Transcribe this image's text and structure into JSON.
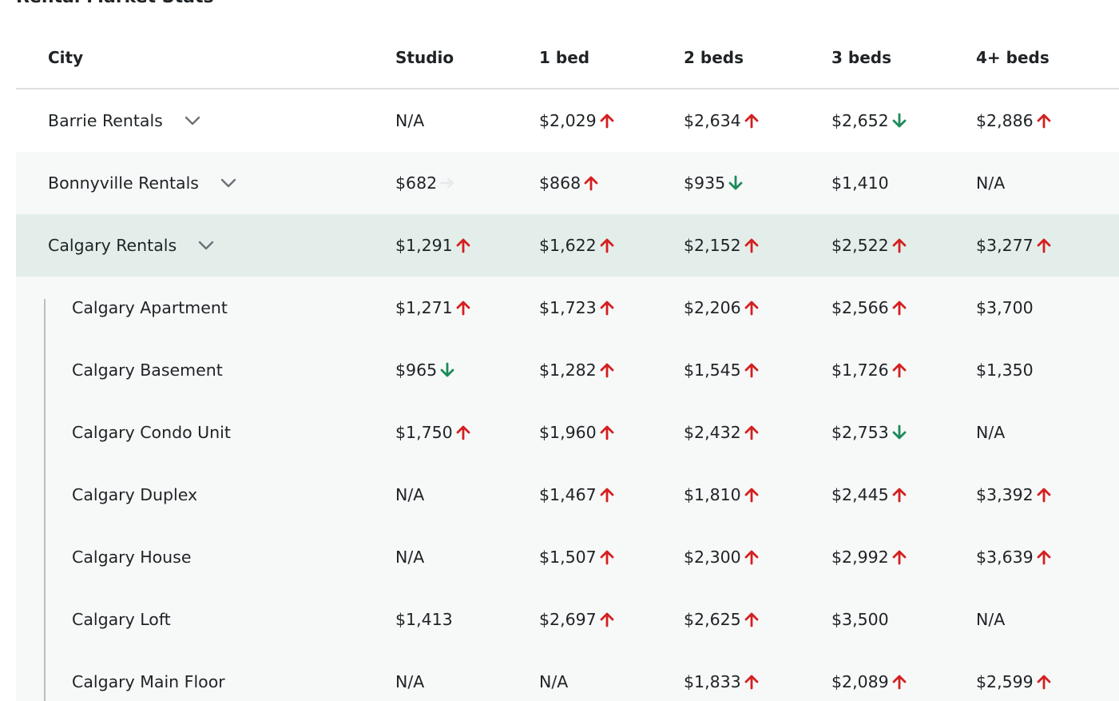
{
  "section_title": "Rental Market Stats",
  "colors": {
    "up": "#d41f1f",
    "down": "#1d8a5a",
    "flat": "#e6e9eb",
    "highlight_row": "#e3eeea",
    "alt_row": "#f7f8f8"
  },
  "columns": [
    "City",
    "Studio",
    "1 bed",
    "2 beds",
    "3 beds",
    "4+ beds"
  ],
  "rows": [
    {
      "city": "Barrie Rentals",
      "expandable": true,
      "child": false,
      "style": "plain",
      "cells": [
        {
          "value": "N/A",
          "trend": "none"
        },
        {
          "value": "$2,029",
          "trend": "up"
        },
        {
          "value": "$2,634",
          "trend": "up"
        },
        {
          "value": "$2,652",
          "trend": "down"
        },
        {
          "value": "$2,886",
          "trend": "up"
        }
      ]
    },
    {
      "city": "Bonnyville Rentals",
      "expandable": true,
      "child": false,
      "style": "alt",
      "cells": [
        {
          "value": "$682",
          "trend": "flat"
        },
        {
          "value": "$868",
          "trend": "up"
        },
        {
          "value": "$935",
          "trend": "down"
        },
        {
          "value": "$1,410",
          "trend": "none"
        },
        {
          "value": "N/A",
          "trend": "none"
        }
      ]
    },
    {
      "city": "Calgary Rentals",
      "expandable": true,
      "child": false,
      "style": "highlight",
      "cells": [
        {
          "value": "$1,291",
          "trend": "up"
        },
        {
          "value": "$1,622",
          "trend": "up"
        },
        {
          "value": "$2,152",
          "trend": "up"
        },
        {
          "value": "$2,522",
          "trend": "up"
        },
        {
          "value": "$3,277",
          "trend": "up"
        }
      ]
    },
    {
      "city": "Calgary Apartment",
      "expandable": false,
      "child": true,
      "style": "alt",
      "cells": [
        {
          "value": "$1,271",
          "trend": "up"
        },
        {
          "value": "$1,723",
          "trend": "up"
        },
        {
          "value": "$2,206",
          "trend": "up"
        },
        {
          "value": "$2,566",
          "trend": "up"
        },
        {
          "value": "$3,700",
          "trend": "none"
        }
      ]
    },
    {
      "city": "Calgary Basement",
      "expandable": false,
      "child": true,
      "style": "alt",
      "cells": [
        {
          "value": "$965",
          "trend": "down"
        },
        {
          "value": "$1,282",
          "trend": "up"
        },
        {
          "value": "$1,545",
          "trend": "up"
        },
        {
          "value": "$1,726",
          "trend": "up"
        },
        {
          "value": "$1,350",
          "trend": "none"
        }
      ]
    },
    {
      "city": "Calgary Condo Unit",
      "expandable": false,
      "child": true,
      "style": "alt",
      "cells": [
        {
          "value": "$1,750",
          "trend": "up"
        },
        {
          "value": "$1,960",
          "trend": "up"
        },
        {
          "value": "$2,432",
          "trend": "up"
        },
        {
          "value": "$2,753",
          "trend": "down"
        },
        {
          "value": "N/A",
          "trend": "none"
        }
      ]
    },
    {
      "city": "Calgary Duplex",
      "expandable": false,
      "child": true,
      "style": "alt",
      "cells": [
        {
          "value": "N/A",
          "trend": "none"
        },
        {
          "value": "$1,467",
          "trend": "up"
        },
        {
          "value": "$1,810",
          "trend": "up"
        },
        {
          "value": "$2,445",
          "trend": "up"
        },
        {
          "value": "$3,392",
          "trend": "up"
        }
      ]
    },
    {
      "city": "Calgary House",
      "expandable": false,
      "child": true,
      "style": "alt",
      "cells": [
        {
          "value": "N/A",
          "trend": "none"
        },
        {
          "value": "$1,507",
          "trend": "up"
        },
        {
          "value": "$2,300",
          "trend": "up"
        },
        {
          "value": "$2,992",
          "trend": "up"
        },
        {
          "value": "$3,639",
          "trend": "up"
        }
      ]
    },
    {
      "city": "Calgary Loft",
      "expandable": false,
      "child": true,
      "style": "alt",
      "cells": [
        {
          "value": "$1,413",
          "trend": "none"
        },
        {
          "value": "$2,697",
          "trend": "up"
        },
        {
          "value": "$2,625",
          "trend": "up"
        },
        {
          "value": "$3,500",
          "trend": "none"
        },
        {
          "value": "N/A",
          "trend": "none"
        }
      ]
    },
    {
      "city": "Calgary Main Floor",
      "expandable": false,
      "child": true,
      "style": "alt",
      "cells": [
        {
          "value": "N/A",
          "trend": "none"
        },
        {
          "value": "N/A",
          "trend": "none"
        },
        {
          "value": "$1,833",
          "trend": "up"
        },
        {
          "value": "$2,089",
          "trend": "up"
        },
        {
          "value": "$2,599",
          "trend": "up"
        }
      ]
    }
  ]
}
